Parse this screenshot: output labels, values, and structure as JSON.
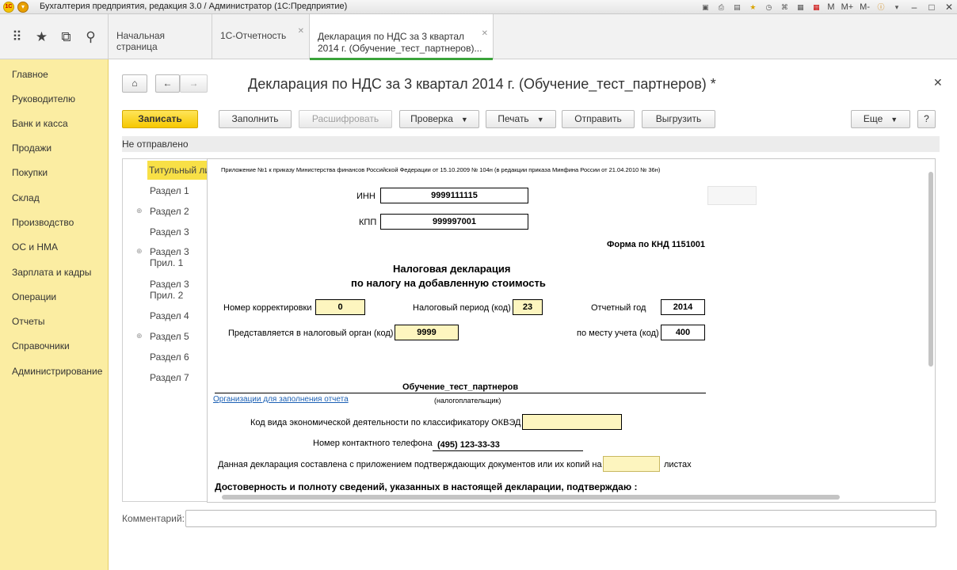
{
  "window": {
    "logo": "1С",
    "title": "Бухгалтерия предприятия, редакция 3.0 / Администратор  (1С:Предприятие)",
    "memory_buttons": [
      "M",
      "M+",
      "M-"
    ]
  },
  "nav": {
    "tabs": [
      {
        "label": "Начальная страница"
      },
      {
        "label": "1С-Отчетность"
      },
      {
        "label_line1": "Декларация по НДС за 3 квартал",
        "label_line2": "2014 г. (Обучение_тест_партнеров)..."
      }
    ]
  },
  "sidebar": {
    "items": [
      "Главное",
      "Руководителю",
      "Банк и касса",
      "Продажи",
      "Покупки",
      "Склад",
      "Производство",
      "ОС и НМА",
      "Зарплата и кадры",
      "Операции",
      "Отчеты",
      "Справочники",
      "Администрирование"
    ]
  },
  "header": {
    "title": "Декларация по НДС за 3 квартал 2014 г. (Обучение_тест_партнеров) *"
  },
  "toolbar": {
    "save": "Записать",
    "fill": "Заполнить",
    "decode": "Расшифровать",
    "check": "Проверка",
    "print": "Печать",
    "send": "Отправить",
    "export": "Выгрузить",
    "more": "Еще",
    "help": "?"
  },
  "status": "Не отправлено",
  "sections": {
    "title_page": "Титульный лист",
    "items": [
      {
        "label": "Раздел 1"
      },
      {
        "label": "Раздел 2"
      },
      {
        "label": "Раздел 3"
      },
      {
        "label_line1": "Раздел 3",
        "label_line2": "Прил. 1"
      },
      {
        "label_line1": "Раздел 3",
        "label_line2": "Прил. 2"
      },
      {
        "label": "Раздел 4"
      },
      {
        "label": "Раздел 5"
      },
      {
        "label": "Раздел 6"
      },
      {
        "label": "Раздел 7"
      }
    ]
  },
  "form": {
    "header_note": "Приложение №1 к приказу Министерства финансов Российской Федерации от 15.10.2009 № 104н (в редакции приказа Минфина России от 21.04.2010 № 36н)",
    "inn_label": "ИНН",
    "inn_value": "9999111115",
    "kpp_label": "КПП",
    "kpp_value": "999997001",
    "knd": "Форма по КНД 1151001",
    "title_line1": "Налоговая декларация",
    "title_line2": "по налогу на добавленную стоимость",
    "correction_label": "Номер корректировки",
    "correction_value": "0",
    "period_label": "Налоговый период (код)",
    "period_value": "23",
    "year_label": "Отчетный год",
    "year_value": "2014",
    "authority_label": "Представляется в налоговый орган (код)",
    "authority_value": "9999",
    "place_label": "по месту учета (код)",
    "place_value": "400",
    "org_name": "Обучение_тест_партнеров",
    "org_link": "Организации для заполнения отчета",
    "taxpayer_caption": "(налогоплательщик)",
    "okved_label": "Код вида экономической деятельности по классификатору ОКВЭД",
    "okved_value": "",
    "phone_label": "Номер контактного телефона",
    "phone_value": "(495) 123-33-33",
    "attach_label": "Данная декларация составлена с приложением подтверждающих документов или их копий на",
    "attach_value": "",
    "attach_suffix": "листах",
    "confirm_text": "Достоверность и полноту сведений, указанных в настоящей декларации, подтверждаю :"
  },
  "comment": {
    "label": "Комментарий:",
    "value": ""
  }
}
